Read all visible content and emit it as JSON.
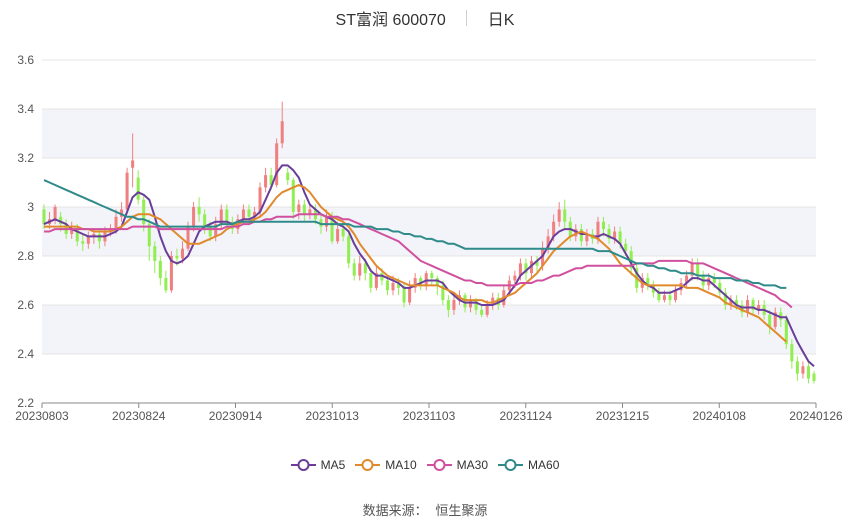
{
  "chart_data": {
    "type": "candlestick",
    "title": "ST富润 600070",
    "subtitle": "日K",
    "source_label": "数据来源：",
    "source_name": "恒生聚源",
    "ylim": [
      2.2,
      3.6
    ],
    "yticks": [
      "2.2",
      "2.4",
      "2.6",
      "2.8",
      "3",
      "3.2",
      "3.4",
      "3.6"
    ],
    "xticks": [
      "20230803",
      "20230824",
      "20230914",
      "20231013",
      "20231103",
      "20231124",
      "20231215",
      "20240108",
      "20240126"
    ],
    "up_color": "#f08080",
    "down_color": "#90ee50",
    "candles": [
      [
        2.99,
        2.93,
        3.01,
        2.91
      ],
      [
        2.93,
        2.95,
        2.98,
        2.91
      ],
      [
        2.95,
        3.0,
        3.01,
        2.93
      ],
      [
        2.96,
        2.93,
        2.98,
        2.9
      ],
      [
        2.93,
        2.89,
        2.95,
        2.87
      ],
      [
        2.89,
        2.91,
        2.94,
        2.87
      ],
      [
        2.91,
        2.86,
        2.93,
        2.84
      ],
      [
        2.86,
        2.85,
        2.89,
        2.82
      ],
      [
        2.85,
        2.88,
        2.9,
        2.83
      ],
      [
        2.88,
        2.89,
        2.91,
        2.85
      ],
      [
        2.89,
        2.86,
        2.91,
        2.83
      ],
      [
        2.86,
        2.9,
        2.92,
        2.84
      ],
      [
        2.9,
        2.91,
        2.93,
        2.88
      ],
      [
        2.91,
        2.96,
        2.99,
        2.89
      ],
      [
        2.96,
        2.99,
        3.02,
        2.94
      ],
      [
        2.99,
        3.14,
        3.16,
        2.98
      ],
      [
        3.16,
        3.19,
        3.3,
        3.08
      ],
      [
        3.12,
        3.03,
        3.15,
        3.01
      ],
      [
        3.03,
        2.93,
        3.05,
        2.9
      ],
      [
        2.93,
        2.84,
        2.95,
        2.78
      ],
      [
        2.84,
        2.78,
        2.86,
        2.73
      ],
      [
        2.78,
        2.71,
        2.8,
        2.68
      ],
      [
        2.71,
        2.66,
        2.74,
        2.65
      ],
      [
        2.66,
        2.8,
        2.82,
        2.65
      ],
      [
        2.8,
        2.79,
        2.83,
        2.76
      ],
      [
        2.79,
        2.83,
        2.86,
        2.77
      ],
      [
        2.83,
        2.92,
        2.94,
        2.82
      ],
      [
        2.92,
        3.0,
        3.02,
        2.9
      ],
      [
        3.0,
        2.97,
        3.04,
        2.94
      ],
      [
        2.97,
        2.92,
        2.99,
        2.89
      ],
      [
        2.92,
        2.88,
        2.94,
        2.86
      ],
      [
        2.88,
        2.93,
        2.96,
        2.86
      ],
      [
        2.93,
        2.99,
        3.01,
        2.91
      ],
      [
        2.99,
        2.94,
        3.01,
        2.92
      ],
      [
        2.94,
        2.91,
        2.96,
        2.89
      ],
      [
        2.91,
        2.95,
        2.97,
        2.89
      ],
      [
        2.95,
        2.99,
        3.01,
        2.93
      ],
      [
        2.99,
        2.96,
        3.01,
        2.93
      ],
      [
        2.96,
        2.98,
        3.0,
        2.94
      ],
      [
        2.98,
        3.08,
        3.1,
        2.96
      ],
      [
        3.08,
        3.13,
        3.16,
        3.06
      ],
      [
        3.13,
        3.09,
        3.16,
        3.07
      ],
      [
        3.09,
        3.26,
        3.28,
        3.08
      ],
      [
        3.26,
        3.35,
        3.43,
        3.24
      ],
      [
        3.14,
        3.11,
        3.16,
        3.09
      ],
      [
        3.11,
        2.98,
        3.12,
        2.95
      ],
      [
        2.98,
        3.01,
        3.03,
        2.95
      ],
      [
        3.01,
        2.97,
        3.03,
        2.94
      ],
      [
        2.97,
        2.99,
        3.01,
        2.95
      ],
      [
        2.99,
        2.95,
        3.01,
        2.93
      ],
      [
        2.95,
        2.92,
        2.97,
        2.89
      ],
      [
        2.92,
        2.96,
        2.99,
        2.9
      ],
      [
        2.96,
        2.86,
        2.98,
        2.85
      ],
      [
        2.86,
        2.91,
        2.94,
        2.85
      ],
      [
        2.91,
        2.88,
        2.94,
        2.86
      ],
      [
        2.88,
        2.77,
        2.9,
        2.75
      ],
      [
        2.77,
        2.72,
        2.79,
        2.7
      ],
      [
        2.72,
        2.77,
        2.8,
        2.7
      ],
      [
        2.77,
        2.73,
        2.79,
        2.7
      ],
      [
        2.73,
        2.67,
        2.75,
        2.65
      ],
      [
        2.67,
        2.73,
        2.76,
        2.66
      ],
      [
        2.73,
        2.7,
        2.75,
        2.68
      ],
      [
        2.7,
        2.66,
        2.72,
        2.64
      ],
      [
        2.66,
        2.69,
        2.72,
        2.64
      ],
      [
        2.69,
        2.67,
        2.71,
        2.64
      ],
      [
        2.67,
        2.61,
        2.69,
        2.59
      ],
      [
        2.61,
        2.67,
        2.7,
        2.6
      ],
      [
        2.67,
        2.71,
        2.73,
        2.65
      ],
      [
        2.71,
        2.68,
        2.72,
        2.66
      ],
      [
        2.68,
        2.73,
        2.74,
        2.66
      ],
      [
        2.73,
        2.71,
        2.74,
        2.68
      ],
      [
        2.71,
        2.68,
        2.72,
        2.64
      ],
      [
        2.68,
        2.62,
        2.7,
        2.6
      ],
      [
        2.62,
        2.58,
        2.64,
        2.55
      ],
      [
        2.58,
        2.62,
        2.64,
        2.56
      ],
      [
        2.62,
        2.64,
        2.66,
        2.6
      ],
      [
        2.64,
        2.59,
        2.65,
        2.57
      ],
      [
        2.59,
        2.62,
        2.64,
        2.57
      ],
      [
        2.62,
        2.58,
        2.63,
        2.56
      ],
      [
        2.58,
        2.56,
        2.6,
        2.55
      ],
      [
        2.56,
        2.6,
        2.62,
        2.55
      ],
      [
        2.6,
        2.63,
        2.65,
        2.58
      ],
      [
        2.63,
        2.6,
        2.65,
        2.58
      ],
      [
        2.6,
        2.66,
        2.68,
        2.59
      ],
      [
        2.66,
        2.7,
        2.72,
        2.64
      ],
      [
        2.7,
        2.72,
        2.74,
        2.67
      ],
      [
        2.72,
        2.77,
        2.79,
        2.7
      ],
      [
        2.77,
        2.73,
        2.79,
        2.7
      ],
      [
        2.73,
        2.78,
        2.8,
        2.71
      ],
      [
        2.78,
        2.76,
        2.8,
        2.73
      ],
      [
        2.76,
        2.83,
        2.86,
        2.74
      ],
      [
        2.83,
        2.88,
        2.91,
        2.81
      ],
      [
        2.88,
        2.94,
        2.97,
        2.86
      ],
      [
        2.94,
        2.99,
        3.02,
        2.92
      ],
      [
        2.99,
        2.94,
        3.03,
        2.91
      ],
      [
        2.94,
        2.88,
        2.96,
        2.86
      ],
      [
        2.88,
        2.91,
        2.93,
        2.86
      ],
      [
        2.91,
        2.86,
        2.93,
        2.84
      ],
      [
        2.86,
        2.89,
        2.91,
        2.84
      ],
      [
        2.89,
        2.87,
        2.91,
        2.85
      ],
      [
        2.87,
        2.94,
        2.96,
        2.85
      ],
      [
        2.94,
        2.91,
        2.96,
        2.88
      ],
      [
        2.91,
        2.87,
        2.93,
        2.85
      ],
      [
        2.87,
        2.9,
        2.92,
        2.85
      ],
      [
        2.9,
        2.85,
        2.92,
        2.83
      ],
      [
        2.85,
        2.82,
        2.87,
        2.8
      ],
      [
        2.82,
        2.75,
        2.84,
        2.72
      ],
      [
        2.75,
        2.67,
        2.77,
        2.65
      ],
      [
        2.67,
        2.71,
        2.73,
        2.65
      ],
      [
        2.71,
        2.68,
        2.73,
        2.66
      ],
      [
        2.68,
        2.65,
        2.7,
        2.63
      ],
      [
        2.65,
        2.62,
        2.67,
        2.61
      ],
      [
        2.62,
        2.64,
        2.66,
        2.61
      ],
      [
        2.64,
        2.62,
        2.66,
        2.6
      ],
      [
        2.62,
        2.66,
        2.68,
        2.61
      ],
      [
        2.66,
        2.69,
        2.71,
        2.64
      ],
      [
        2.69,
        2.72,
        2.74,
        2.67
      ],
      [
        2.72,
        2.77,
        2.79,
        2.7
      ],
      [
        2.77,
        2.72,
        2.79,
        2.7
      ],
      [
        2.72,
        2.68,
        2.74,
        2.66
      ],
      [
        2.68,
        2.71,
        2.73,
        2.66
      ],
      [
        2.71,
        2.69,
        2.73,
        2.67
      ],
      [
        2.69,
        2.65,
        2.71,
        2.63
      ],
      [
        2.65,
        2.6,
        2.67,
        2.58
      ],
      [
        2.6,
        2.62,
        2.64,
        2.58
      ],
      [
        2.62,
        2.6,
        2.64,
        2.58
      ],
      [
        2.6,
        2.57,
        2.62,
        2.55
      ],
      [
        2.57,
        2.62,
        2.64,
        2.55
      ],
      [
        2.62,
        2.58,
        2.63,
        2.56
      ],
      [
        2.58,
        2.6,
        2.62,
        2.56
      ],
      [
        2.6,
        2.56,
        2.62,
        2.54
      ],
      [
        2.56,
        2.51,
        2.58,
        2.48
      ],
      [
        2.51,
        2.57,
        2.59,
        2.5
      ],
      [
        2.57,
        2.54,
        2.59,
        2.51
      ],
      [
        2.54,
        2.44,
        2.56,
        2.42
      ],
      [
        2.44,
        2.37,
        2.46,
        2.34
      ],
      [
        2.37,
        2.32,
        2.39,
        2.29
      ],
      [
        2.32,
        2.35,
        2.37,
        2.3
      ],
      [
        2.35,
        2.3,
        2.37,
        2.28
      ],
      [
        2.32,
        2.29,
        2.33,
        2.28
      ]
    ],
    "series": [
      {
        "name": "MA5",
        "color": "#6a3d9a",
        "values": [
          2.93,
          2.94,
          2.95,
          2.94,
          2.93,
          2.91,
          2.9,
          2.89,
          2.88,
          2.88,
          2.88,
          2.88,
          2.89,
          2.9,
          2.92,
          2.98,
          3.04,
          3.06,
          3.05,
          3.03,
          2.96,
          2.88,
          2.82,
          2.78,
          2.77,
          2.78,
          2.8,
          2.85,
          2.9,
          2.92,
          2.93,
          2.94,
          2.94,
          2.94,
          2.93,
          2.94,
          2.95,
          2.95,
          2.96,
          2.98,
          3.03,
          3.08,
          3.14,
          3.17,
          3.17,
          3.15,
          3.12,
          3.06,
          3.01,
          2.99,
          2.97,
          2.96,
          2.95,
          2.93,
          2.92,
          2.9,
          2.85,
          2.81,
          2.78,
          2.74,
          2.72,
          2.72,
          2.71,
          2.7,
          2.69,
          2.67,
          2.67,
          2.68,
          2.69,
          2.7,
          2.7,
          2.7,
          2.69,
          2.66,
          2.64,
          2.62,
          2.61,
          2.61,
          2.61,
          2.6,
          2.6,
          2.6,
          2.61,
          2.62,
          2.65,
          2.68,
          2.72,
          2.74,
          2.76,
          2.78,
          2.8,
          2.84,
          2.88,
          2.9,
          2.91,
          2.91,
          2.9,
          2.89,
          2.89,
          2.88,
          2.88,
          2.89,
          2.88,
          2.87,
          2.85,
          2.81,
          2.77,
          2.73,
          2.7,
          2.68,
          2.67,
          2.65,
          2.65,
          2.65,
          2.66,
          2.67,
          2.69,
          2.71,
          2.71,
          2.7,
          2.7,
          2.68,
          2.66,
          2.64,
          2.62,
          2.6,
          2.59,
          2.59,
          2.59,
          2.58,
          2.58,
          2.57,
          2.56,
          2.55,
          2.55,
          2.5,
          2.45,
          2.41,
          2.37,
          2.35
        ]
      },
      {
        "name": "MA10",
        "color": "#e08a2c",
        "values": [
          2.92,
          2.92,
          2.92,
          2.92,
          2.92,
          2.92,
          2.92,
          2.91,
          2.91,
          2.9,
          2.9,
          2.9,
          2.9,
          2.91,
          2.92,
          2.94,
          2.96,
          2.97,
          2.97,
          2.97,
          2.96,
          2.95,
          2.93,
          2.91,
          2.89,
          2.87,
          2.85,
          2.85,
          2.85,
          2.86,
          2.87,
          2.88,
          2.89,
          2.91,
          2.92,
          2.93,
          2.94,
          2.94,
          2.95,
          2.96,
          2.98,
          3.01,
          3.04,
          3.06,
          3.07,
          3.08,
          3.09,
          3.08,
          3.06,
          3.03,
          3.0,
          2.98,
          2.96,
          2.95,
          2.94,
          2.92,
          2.89,
          2.85,
          2.82,
          2.79,
          2.76,
          2.74,
          2.72,
          2.71,
          2.7,
          2.69,
          2.68,
          2.68,
          2.68,
          2.68,
          2.68,
          2.68,
          2.67,
          2.66,
          2.65,
          2.63,
          2.62,
          2.62,
          2.62,
          2.62,
          2.61,
          2.61,
          2.62,
          2.63,
          2.64,
          2.65,
          2.67,
          2.69,
          2.71,
          2.73,
          2.76,
          2.79,
          2.82,
          2.84,
          2.86,
          2.88,
          2.89,
          2.9,
          2.89,
          2.88,
          2.87,
          2.85,
          2.83,
          2.8,
          2.77,
          2.75,
          2.73,
          2.71,
          2.69,
          2.68,
          2.68,
          2.68,
          2.68,
          2.68,
          2.68,
          2.68,
          2.67,
          2.67,
          2.67,
          2.66,
          2.65,
          2.64,
          2.63,
          2.61,
          2.6,
          2.59,
          2.58,
          2.57,
          2.56,
          2.55,
          2.53,
          2.51,
          2.49,
          2.47,
          2.45
        ]
      },
      {
        "name": "MA30",
        "color": "#d0509f",
        "values": [
          2.9,
          2.9,
          2.91,
          2.91,
          2.91,
          2.91,
          2.91,
          2.91,
          2.91,
          2.91,
          2.91,
          2.91,
          2.91,
          2.91,
          2.91,
          2.91,
          2.92,
          2.92,
          2.92,
          2.92,
          2.92,
          2.91,
          2.91,
          2.91,
          2.91,
          2.91,
          2.91,
          2.91,
          2.91,
          2.91,
          2.91,
          2.91,
          2.91,
          2.92,
          2.92,
          2.92,
          2.93,
          2.93,
          2.94,
          2.94,
          2.95,
          2.95,
          2.96,
          2.96,
          2.96,
          2.96,
          2.97,
          2.97,
          2.97,
          2.97,
          2.97,
          2.96,
          2.96,
          2.96,
          2.95,
          2.95,
          2.94,
          2.93,
          2.92,
          2.91,
          2.9,
          2.89,
          2.88,
          2.87,
          2.86,
          2.84,
          2.82,
          2.8,
          2.78,
          2.77,
          2.76,
          2.75,
          2.74,
          2.73,
          2.72,
          2.71,
          2.7,
          2.7,
          2.69,
          2.69,
          2.68,
          2.68,
          2.68,
          2.68,
          2.68,
          2.68,
          2.69,
          2.69,
          2.69,
          2.7,
          2.7,
          2.71,
          2.72,
          2.72,
          2.73,
          2.74,
          2.75,
          2.75,
          2.76,
          2.76,
          2.76,
          2.76,
          2.76,
          2.76,
          2.76,
          2.76,
          2.76,
          2.77,
          2.77,
          2.77,
          2.77,
          2.78,
          2.78,
          2.78,
          2.78,
          2.78,
          2.78,
          2.77,
          2.77,
          2.77,
          2.76,
          2.75,
          2.74,
          2.73,
          2.72,
          2.71,
          2.7,
          2.69,
          2.68,
          2.67,
          2.66,
          2.65,
          2.64,
          2.62,
          2.61,
          2.59
        ]
      },
      {
        "name": "MA60",
        "color": "#2f8a8a",
        "values": [
          3.11,
          3.1,
          3.09,
          3.08,
          3.07,
          3.06,
          3.05,
          3.04,
          3.03,
          3.02,
          3.01,
          3.0,
          2.99,
          2.98,
          2.97,
          2.96,
          2.96,
          2.95,
          2.95,
          2.94,
          2.93,
          2.92,
          2.92,
          2.92,
          2.92,
          2.92,
          2.92,
          2.92,
          2.92,
          2.92,
          2.92,
          2.92,
          2.93,
          2.93,
          2.93,
          2.94,
          2.94,
          2.94,
          2.94,
          2.94,
          2.94,
          2.94,
          2.94,
          2.94,
          2.94,
          2.94,
          2.94,
          2.94,
          2.94,
          2.94,
          2.93,
          2.93,
          2.93,
          2.93,
          2.93,
          2.93,
          2.92,
          2.92,
          2.92,
          2.92,
          2.91,
          2.91,
          2.91,
          2.9,
          2.9,
          2.89,
          2.89,
          2.88,
          2.88,
          2.87,
          2.87,
          2.86,
          2.86,
          2.85,
          2.85,
          2.84,
          2.83,
          2.83,
          2.83,
          2.83,
          2.83,
          2.83,
          2.83,
          2.83,
          2.83,
          2.83,
          2.83,
          2.83,
          2.83,
          2.83,
          2.83,
          2.83,
          2.83,
          2.83,
          2.83,
          2.83,
          2.83,
          2.83,
          2.83,
          2.83,
          2.82,
          2.82,
          2.82,
          2.81,
          2.8,
          2.79,
          2.78,
          2.77,
          2.77,
          2.76,
          2.76,
          2.75,
          2.75,
          2.74,
          2.74,
          2.73,
          2.73,
          2.73,
          2.72,
          2.72,
          2.72,
          2.71,
          2.71,
          2.71,
          2.71,
          2.7,
          2.7,
          2.7,
          2.69,
          2.69,
          2.68,
          2.68,
          2.68,
          2.67,
          2.67
        ]
      }
    ]
  }
}
